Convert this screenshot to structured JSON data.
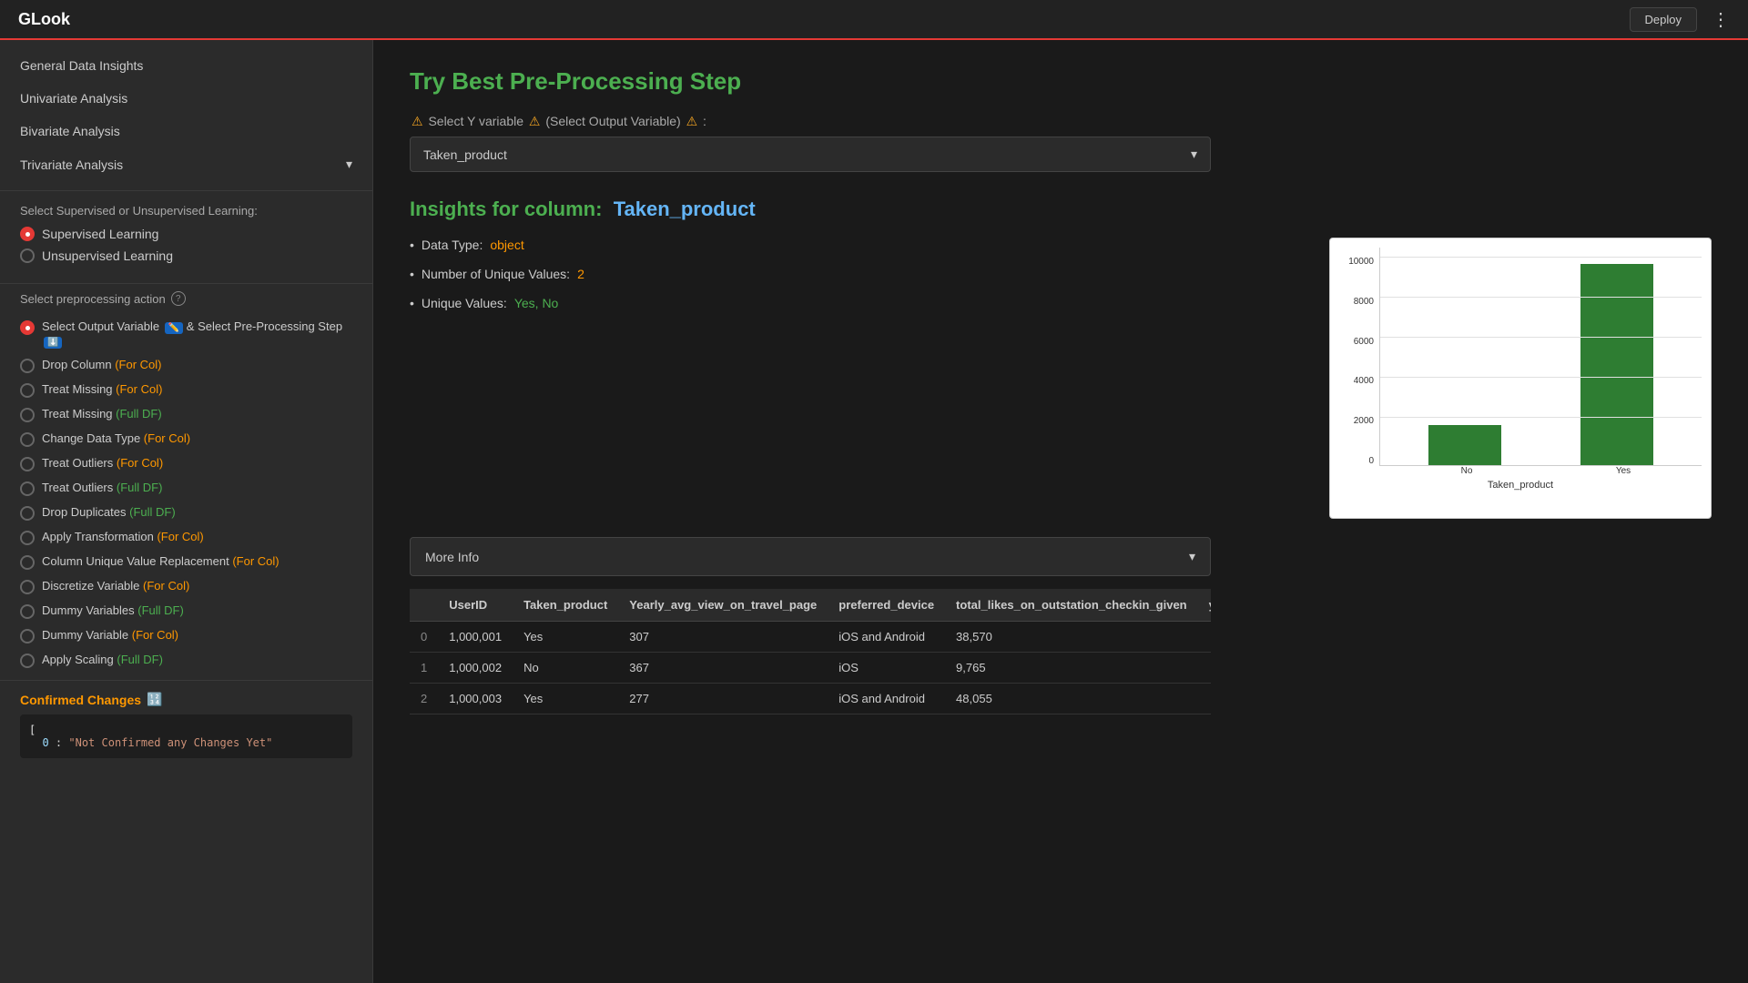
{
  "topbar": {
    "logo": "GLook",
    "deploy_label": "Deploy",
    "dots_label": "⋮"
  },
  "sidebar": {
    "nav_items": [
      {
        "label": "General Data Insights",
        "arrow": false
      },
      {
        "label": "Univariate Analysis",
        "arrow": false
      },
      {
        "label": "Bivariate Analysis",
        "arrow": false
      },
      {
        "label": "Trivariate Analysis",
        "arrow": true
      }
    ],
    "learning_section_title": "Select Supervised or Unsupervised Learning:",
    "learning_options": [
      {
        "label": "Supervised Learning",
        "selected": true
      },
      {
        "label": "Unsupervised Learning",
        "selected": false
      }
    ],
    "preprocess_section_title": "Select preprocessing action",
    "preprocess_items": [
      {
        "label": "Select Output Variable",
        "badge": "✏️",
        "suffix": " & Select Pre-Processing Step",
        "badge2": "⬇️",
        "color": "none",
        "selected": true
      },
      {
        "label": "Drop Column",
        "suffix": " (For Col)",
        "color": "orange",
        "selected": false
      },
      {
        "label": "Treat Missing",
        "suffix": " (For Col)",
        "color": "orange",
        "selected": false
      },
      {
        "label": "Treat Missing",
        "suffix": " (Full DF)",
        "color": "green",
        "selected": false
      },
      {
        "label": "Change Data Type",
        "suffix": " (For Col)",
        "color": "orange",
        "selected": false
      },
      {
        "label": "Treat Outliers",
        "suffix": " (For Col)",
        "color": "orange",
        "selected": false
      },
      {
        "label": "Treat Outliers",
        "suffix": " (Full DF)",
        "color": "green",
        "selected": false
      },
      {
        "label": "Drop Duplicates",
        "suffix": " (Full DF)",
        "color": "green",
        "selected": false
      },
      {
        "label": "Apply Transformation",
        "suffix": " (For Col)",
        "color": "orange",
        "selected": false
      },
      {
        "label": "Column Unique Value Replacement",
        "suffix": " (For Col)",
        "color": "orange",
        "selected": false
      },
      {
        "label": "Discretize Variable",
        "suffix": " (For Col)",
        "color": "orange",
        "selected": false
      },
      {
        "label": "Dummy Variables",
        "suffix": " (Full DF)",
        "color": "green",
        "selected": false
      },
      {
        "label": "Dummy Variable",
        "suffix": " (For Col)",
        "color": "orange",
        "selected": false
      },
      {
        "label": "Apply Scaling",
        "suffix": " (Full DF)",
        "color": "green",
        "selected": false
      }
    ],
    "confirmed_changes_label": "Confirmed Changes",
    "confirmed_badge": "🔢",
    "confirmed_code": "[\n  0 : \"Not Confirmed any Changes Yet\""
  },
  "main": {
    "page_title": "Try Best Pre-Processing Step",
    "y_variable_label": "⚠ Select Y variable ⚠ (Select Output Variable) ⚠ :",
    "selected_variable": "Taken_product",
    "dropdown_arrow": "▾",
    "insights_title_prefix": "Insights for column:",
    "insights_col_name": "Taken_product",
    "data_type_label": "Data Type:",
    "data_type_val": "object",
    "unique_count_label": "Number of Unique Values:",
    "unique_count_val": "2",
    "unique_values_label": "Unique Values:",
    "unique_values_val": "Yes, No",
    "more_info_label": "More Info",
    "chart": {
      "y_labels": [
        "10000",
        "8000",
        "6000",
        "4000",
        "2000",
        "0"
      ],
      "x_label": "Taken_product",
      "bars": [
        {
          "label": "No",
          "value": 1900,
          "max": 10000
        },
        {
          "label": "Yes",
          "value": 9600,
          "max": 10000
        }
      ]
    },
    "table": {
      "columns": [
        "",
        "UserID",
        "Taken_product",
        "Yearly_avg_view_on_travel_page",
        "preferred_device",
        "total_likes_on_outstation_checkin_given",
        "yearly"
      ],
      "rows": [
        {
          "idx": "0",
          "userid": "1,000,001",
          "taken": "Yes",
          "yearly_avg": "307",
          "device": "iOS and Android",
          "total_likes": "38,570",
          "yearly": ""
        },
        {
          "idx": "1",
          "userid": "1,000,002",
          "taken": "No",
          "yearly_avg": "367",
          "device": "iOS",
          "total_likes": "9,765",
          "yearly": ""
        },
        {
          "idx": "2",
          "userid": "1,000,003",
          "taken": "Yes",
          "yearly_avg": "277",
          "device": "iOS and Android",
          "total_likes": "48,055",
          "yearly": ""
        }
      ]
    }
  }
}
